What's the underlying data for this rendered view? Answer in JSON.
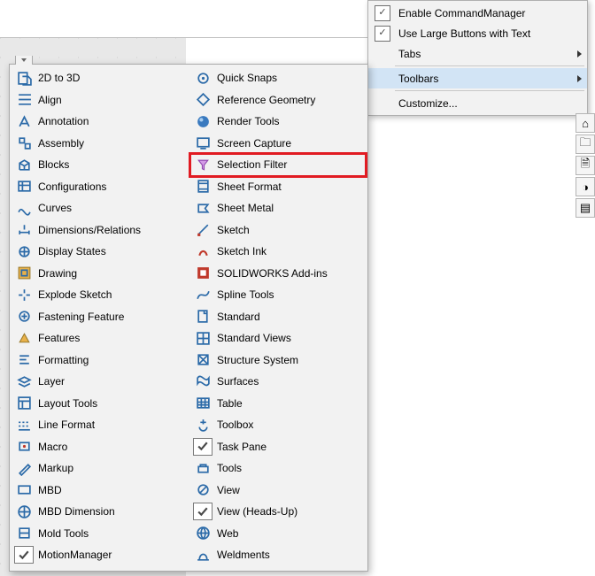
{
  "context_menu": {
    "items": [
      {
        "label": "Enable CommandManager",
        "checked": true,
        "submenu": false
      },
      {
        "label": "Use Large Buttons with Text",
        "checked": true,
        "submenu": false
      },
      {
        "label": "Tabs",
        "checked": false,
        "submenu": true
      },
      {
        "sep": true
      },
      {
        "label": "Toolbars",
        "checked": false,
        "submenu": true,
        "hover": true
      },
      {
        "sep": true
      },
      {
        "label": "Customize...",
        "checked": false,
        "submenu": false
      }
    ]
  },
  "toolbars": {
    "left_column": [
      {
        "label": "2D to 3D",
        "icon": "doc3d",
        "checked": false
      },
      {
        "label": "Align",
        "icon": "align",
        "checked": false
      },
      {
        "label": "Annotation",
        "icon": "annot",
        "checked": false
      },
      {
        "label": "Assembly",
        "icon": "asm",
        "checked": false
      },
      {
        "label": "Blocks",
        "icon": "blocks",
        "checked": false
      },
      {
        "label": "Configurations",
        "icon": "config",
        "checked": false
      },
      {
        "label": "Curves",
        "icon": "curves",
        "checked": false
      },
      {
        "label": "Dimensions/Relations",
        "icon": "dimrel",
        "checked": false
      },
      {
        "label": "Display States",
        "icon": "disp",
        "checked": false
      },
      {
        "label": "Drawing",
        "icon": "draw",
        "checked": false
      },
      {
        "label": "Explode Sketch",
        "icon": "explode",
        "checked": false
      },
      {
        "label": "Fastening Feature",
        "icon": "fasten",
        "checked": false
      },
      {
        "label": "Features",
        "icon": "feat",
        "checked": false
      },
      {
        "label": "Formatting",
        "icon": "format",
        "checked": false
      },
      {
        "label": "Layer",
        "icon": "layer",
        "checked": false
      },
      {
        "label": "Layout Tools",
        "icon": "layout",
        "checked": false
      },
      {
        "label": "Line Format",
        "icon": "linefmt",
        "checked": false
      },
      {
        "label": "Macro",
        "icon": "macro",
        "checked": false
      },
      {
        "label": "Markup",
        "icon": "markup",
        "checked": false
      },
      {
        "label": "MBD",
        "icon": "mbd",
        "checked": false
      },
      {
        "label": "MBD Dimension",
        "icon": "mbddim",
        "checked": false
      },
      {
        "label": "Mold Tools",
        "icon": "mold",
        "checked": false
      },
      {
        "label": "MotionManager",
        "icon": "check",
        "checked": true
      }
    ],
    "right_column": [
      {
        "label": "Quick Snaps",
        "icon": "snaps",
        "checked": false
      },
      {
        "label": "Reference Geometry",
        "icon": "refgeo",
        "checked": false
      },
      {
        "label": "Render Tools",
        "icon": "render",
        "checked": false
      },
      {
        "label": "Screen Capture",
        "icon": "screen",
        "checked": false
      },
      {
        "label": "Selection Filter",
        "icon": "selfilter",
        "checked": false,
        "highlight": true
      },
      {
        "label": "Sheet Format",
        "icon": "sheetfmt",
        "checked": false
      },
      {
        "label": "Sheet Metal",
        "icon": "sheetmtl",
        "checked": false
      },
      {
        "label": "Sketch",
        "icon": "sketch",
        "checked": false
      },
      {
        "label": "Sketch Ink",
        "icon": "ink",
        "checked": false
      },
      {
        "label": "SOLIDWORKS Add-ins",
        "icon": "addins",
        "checked": false
      },
      {
        "label": "Spline Tools",
        "icon": "spline",
        "checked": false
      },
      {
        "label": "Standard",
        "icon": "standard",
        "checked": false
      },
      {
        "label": "Standard Views",
        "icon": "stdviews",
        "checked": false
      },
      {
        "label": "Structure System",
        "icon": "struct",
        "checked": false
      },
      {
        "label": "Surfaces",
        "icon": "surf",
        "checked": false
      },
      {
        "label": "Table",
        "icon": "table",
        "checked": false
      },
      {
        "label": "Toolbox",
        "icon": "toolbox",
        "checked": false
      },
      {
        "label": "Task Pane",
        "icon": "check",
        "checked": true
      },
      {
        "label": "Tools",
        "icon": "tools",
        "checked": false
      },
      {
        "label": "View",
        "icon": "view",
        "checked": false
      },
      {
        "label": "View (Heads-Up)",
        "icon": "check",
        "checked": true
      },
      {
        "label": "Web",
        "icon": "web",
        "checked": false
      },
      {
        "label": "Weldments",
        "icon": "weld",
        "checked": false
      }
    ]
  },
  "right_dock": {
    "buttons": [
      {
        "name": "dock-home-icon",
        "glyph": "⌂"
      },
      {
        "name": "dock-folder-icon",
        "glyph": "🗀"
      },
      {
        "name": "dock-doc-icon",
        "glyph": "🗎"
      },
      {
        "name": "dock-palette-icon",
        "glyph": "◑"
      },
      {
        "name": "dock-layers-icon",
        "glyph": "▤"
      }
    ]
  }
}
